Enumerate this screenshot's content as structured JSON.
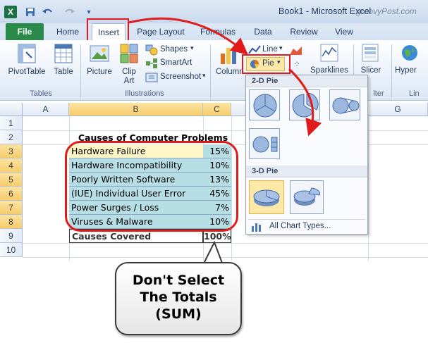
{
  "window": {
    "title": "Book1 - Microsoft Excel",
    "watermark": "groovyPost.com",
    "app_icon": "excel-logo",
    "qat_icons": [
      "save-icon",
      "undo-icon",
      "redo-icon",
      "customize-qat-icon"
    ]
  },
  "tabs": [
    "File",
    "Home",
    "Insert",
    "Page Layout",
    "Formulas",
    "Data",
    "Review",
    "View"
  ],
  "ribbon": {
    "tables": {
      "pivot_label": "PivotTable",
      "table_label": "Table",
      "group_label": "Tables"
    },
    "illustrations": {
      "picture_label": "Picture",
      "clipart_label1": "Clip",
      "clipart_label2": "Art",
      "shapes_label": "Shapes",
      "smartart_label": "SmartArt",
      "screenshot_label": "Screenshot",
      "group_label": "Illustrations"
    },
    "charts": {
      "column_label": "Column",
      "line_label": "Line",
      "pie_label": "Pie"
    },
    "sparklines_label": "Sparklines",
    "slicer_label": "Slicer",
    "filter_group_fragment": "lter",
    "hyperlink_label": "Hyper",
    "links_group_fragment": "Lin"
  },
  "pie_menu": {
    "section_2d": "2-D Pie",
    "section_3d": "3-D Pie",
    "all_chart_types": "All Chart Types..."
  },
  "sheet": {
    "columns": [
      "A",
      "B",
      "C",
      "G"
    ],
    "rows": [
      "1",
      "2",
      "3",
      "4",
      "5",
      "6",
      "7",
      "8",
      "9",
      "10"
    ],
    "title": "Causes of Computer Problems",
    "data": [
      {
        "cause": "Hardware Failure",
        "percent": "15%"
      },
      {
        "cause": "Hardware Incompatibility",
        "percent": "10%"
      },
      {
        "cause": "Poorly Written Software",
        "percent": "13%"
      },
      {
        "cause": "(IUE) Individual User Error",
        "percent": "45%"
      },
      {
        "cause": "Power Surges / Loss",
        "percent": "7%"
      },
      {
        "cause": "Viruses & Malware",
        "percent": "10%"
      }
    ],
    "total_label": "Causes Covered",
    "total_value": "100%"
  },
  "callout": {
    "line1": "Don't Select",
    "line2": "The Totals",
    "line3": "(SUM)"
  },
  "colors": {
    "highlight_red": "#e01b1b",
    "selection_fill": "#b7dde5",
    "file_tab": "#217346",
    "active_cell": "#fff6c8"
  }
}
